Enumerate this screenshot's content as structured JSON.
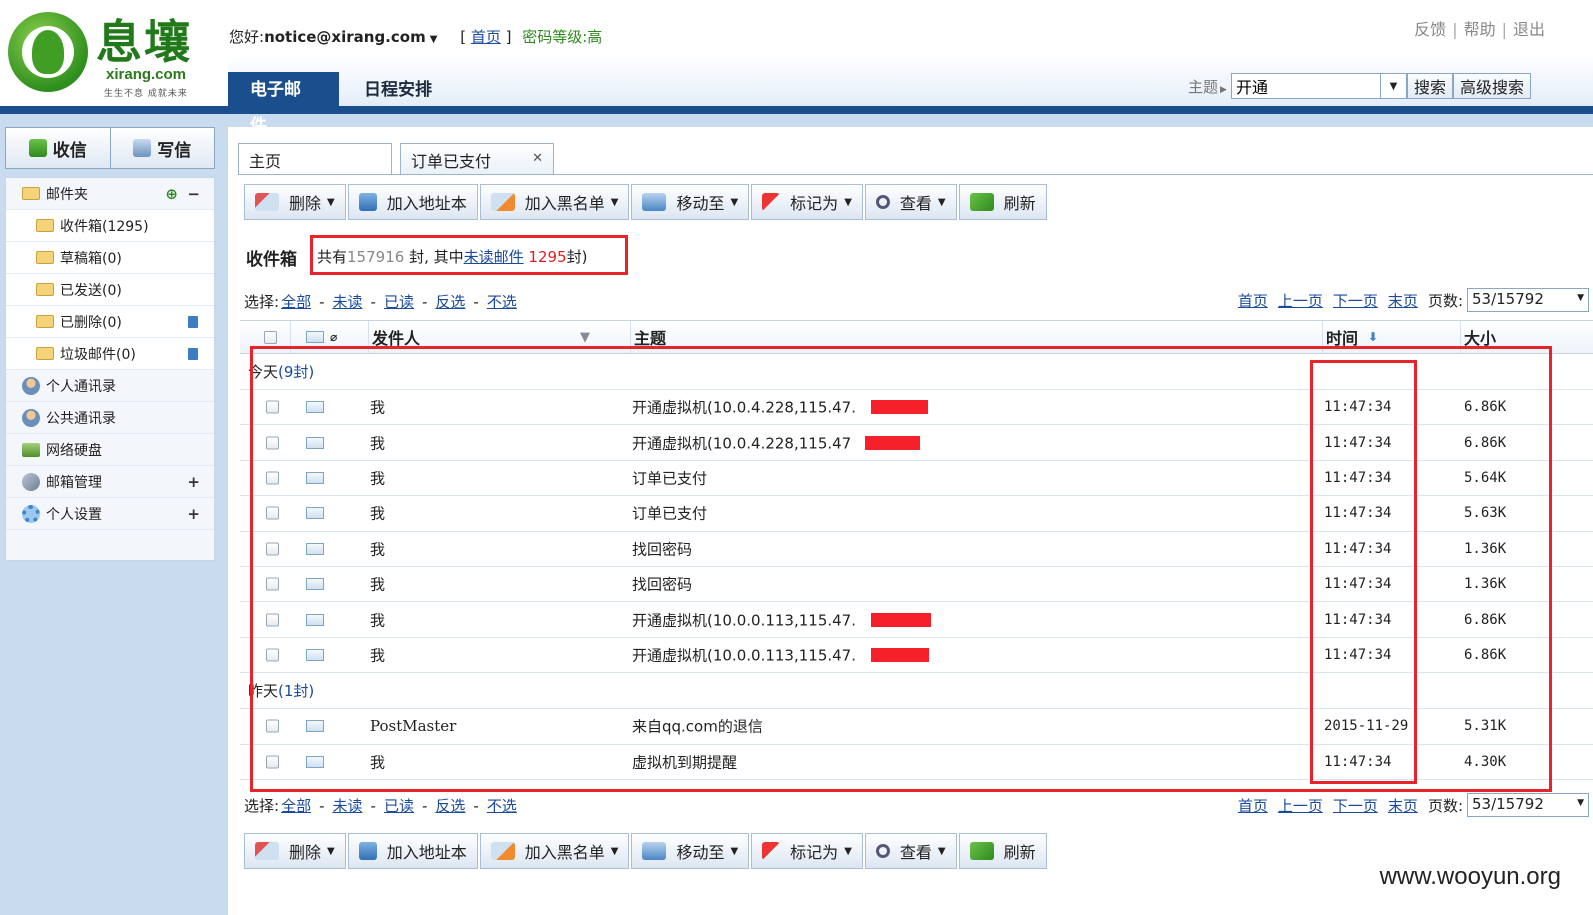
{
  "brand": {
    "name": "息壤",
    "domain": "xirang.com",
    "slogan": "生生不息 成就未来"
  },
  "header": {
    "greeting_prefix": "您好:",
    "user_email": "notice@xirang.com",
    "home_link": "首页",
    "password_level": "密码等级:高",
    "top_links": [
      "反馈",
      "帮助",
      "退出"
    ],
    "nav_tabs": [
      "电子邮件",
      "日程安排"
    ],
    "search": {
      "label": "主题",
      "value": "开通",
      "search_button": "搜索",
      "advanced_button": "高级搜索"
    }
  },
  "sidebar": {
    "receive_button": "收信",
    "compose_button": "写信",
    "folders_title": "邮件夹",
    "folders": [
      {
        "label": "收件箱(1295)"
      },
      {
        "label": "草稿箱(0)"
      },
      {
        "label": "已发送(0)"
      },
      {
        "label": "已删除(0)"
      },
      {
        "label": "垃圾邮件(0)"
      }
    ],
    "menu": [
      {
        "label": "个人通讯录"
      },
      {
        "label": "公共通讯录"
      },
      {
        "label": "网络硬盘"
      },
      {
        "label": "邮箱管理"
      },
      {
        "label": "个人设置"
      }
    ]
  },
  "main": {
    "tabs": [
      {
        "label": "主页"
      },
      {
        "label": "订单已支付"
      }
    ],
    "toolbar": {
      "delete": "删除",
      "add_address": "加入地址本",
      "add_blacklist": "加入黑名单",
      "move_to": "移动至",
      "mark_as": "标记为",
      "view": "查看",
      "refresh": "刷新"
    },
    "inbox": {
      "title": "收件箱",
      "summary_prefix": "共有",
      "total": "157916",
      "summary_mid": "封, 其中",
      "unread_link": "未读邮件",
      "unread_count": "1295",
      "summary_suffix": "封)"
    },
    "select": {
      "label": "选择:",
      "all": "全部",
      "unread": "未读",
      "read": "已读",
      "invert": "反选",
      "none": "不选"
    },
    "pager": {
      "first": "首页",
      "prev": "上一页",
      "next": "下一页",
      "last": "末页",
      "pages_label": "页数:",
      "page_value": "53/15792"
    },
    "columns": {
      "sender": "发件人",
      "subject": "主题",
      "time": "时间",
      "size": "大小"
    },
    "groups": [
      {
        "label": "今天",
        "count": "(9封)"
      },
      {
        "label": "昨天",
        "count": "(1封)"
      }
    ],
    "rows": [
      {
        "sender": "我",
        "subject": "开通虚拟机(10.0.4.228,115.47.",
        "time": "11:47:34",
        "size": "6.86K"
      },
      {
        "sender": "我",
        "subject": "开通虚拟机(10.0.4.228,115.47",
        "time": "11:47:34",
        "size": "6.86K"
      },
      {
        "sender": "我",
        "subject": "订单已支付",
        "time": "11:47:34",
        "size": "5.64K"
      },
      {
        "sender": "我",
        "subject": "订单已支付",
        "time": "11:47:34",
        "size": "5.63K"
      },
      {
        "sender": "我",
        "subject": "找回密码",
        "time": "11:47:34",
        "size": "1.36K"
      },
      {
        "sender": "我",
        "subject": "找回密码",
        "time": "11:47:34",
        "size": "1.36K"
      },
      {
        "sender": "我",
        "subject": "开通虚拟机(10.0.0.113,115.47.",
        "time": "11:47:34",
        "size": "6.86K"
      },
      {
        "sender": "我",
        "subject": "开通虚拟机(10.0.0.113,115.47.",
        "time": "11:47:34",
        "size": "6.86K"
      },
      {
        "sender": "PostMaster",
        "subject": "来自qq.com的退信",
        "time": "2015-11-29",
        "size": "5.31K"
      },
      {
        "sender": "我",
        "subject": "虚拟机到期提醒",
        "time": "11:47:34",
        "size": "4.30K"
      }
    ]
  },
  "watermark": "www.wooyun.org",
  "colors": {
    "nav_active": "#1b4e8c",
    "highlight_box": "#e8232b",
    "password_level": "#2d8a1d",
    "unread_count": "#e02020"
  }
}
